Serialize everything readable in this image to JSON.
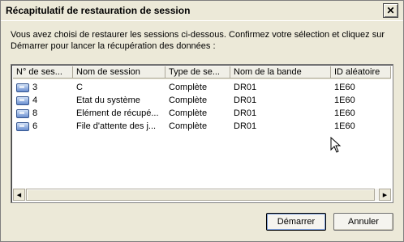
{
  "window": {
    "title": "Récapitulatif de restauration de session",
    "close_glyph": "✕"
  },
  "description": "Vous avez choisi de restaurer les sessions ci-dessous. Confirmez votre sélection et cliquez sur Démarrer pour lancer la récupération des données :",
  "table": {
    "columns": [
      "N° de ses...",
      "Nom de session",
      "Type de se...",
      "Nom de la bande",
      "ID aléatoire"
    ],
    "rows": [
      {
        "num": "3",
        "name": "C",
        "type": "Complète",
        "tape": "DR01",
        "id": "1E60"
      },
      {
        "num": "4",
        "name": "Etat du système",
        "type": "Complète",
        "tape": "DR01",
        "id": "1E60"
      },
      {
        "num": "8",
        "name": "Elément de récupé...",
        "type": "Complète",
        "tape": "DR01",
        "id": "1E60"
      },
      {
        "num": "6",
        "name": "File d'attente des j...",
        "type": "Complète",
        "tape": "DR01",
        "id": "1E60"
      }
    ]
  },
  "buttons": {
    "start": "Démarrer",
    "cancel": "Annuler"
  },
  "scroll": {
    "left_glyph": "◀",
    "right_glyph": "▶"
  }
}
